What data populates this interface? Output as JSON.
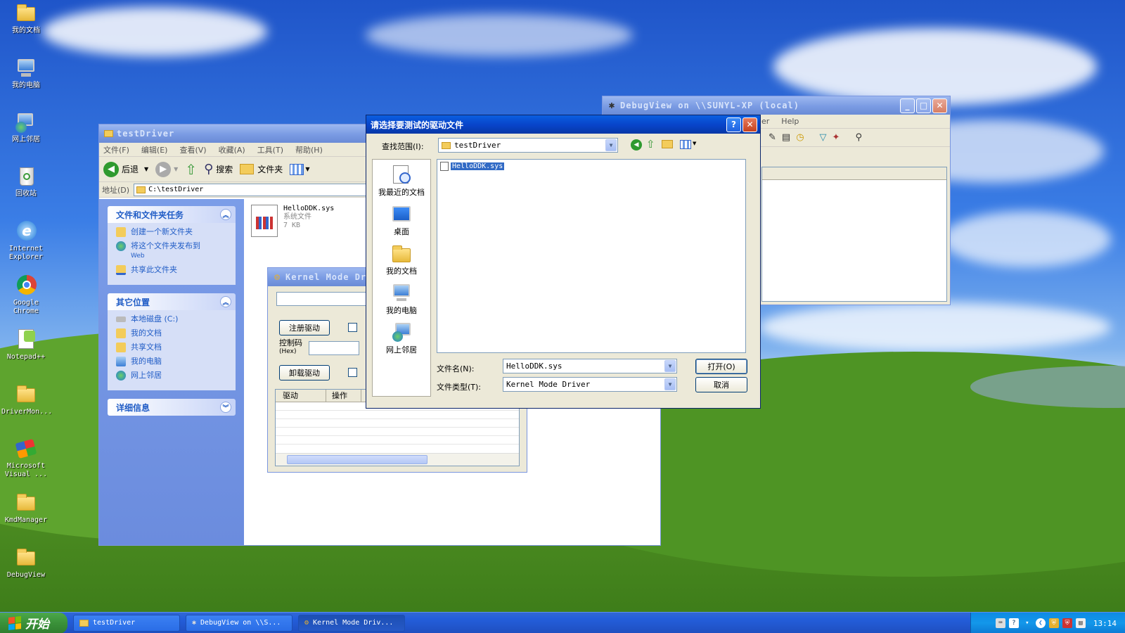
{
  "desktop": {
    "icons": [
      {
        "label": "我的文档"
      },
      {
        "label": "我的电脑"
      },
      {
        "label": "网上邻居"
      },
      {
        "label": "回收站"
      },
      {
        "label": "Internet Explorer"
      },
      {
        "label": "Google Chrome"
      },
      {
        "label": "Notepad++"
      },
      {
        "label": "DriverMon..."
      },
      {
        "label": "Microsoft Visual ..."
      },
      {
        "label": "KmdManager"
      },
      {
        "label": "DebugView"
      }
    ]
  },
  "explorer": {
    "title": "testDriver",
    "menu": [
      "文件(F)",
      "编辑(E)",
      "查看(V)",
      "收藏(A)",
      "工具(T)",
      "帮助(H)"
    ],
    "toolbar": {
      "back": "后退",
      "search": "搜索",
      "folders": "文件夹"
    },
    "address_label": "地址(D)",
    "address_value": "C:\\testDriver",
    "tasks": {
      "title": "文件和文件夹任务",
      "items": [
        {
          "label": "创建一个新文件夹"
        },
        {
          "label": "将这个文件夹发布到",
          "sub": "Web"
        },
        {
          "label": "共享此文件夹"
        }
      ]
    },
    "other_places": {
      "title": "其它位置",
      "items": [
        "本地磁盘 (C:)",
        "我的文档",
        "共享文档",
        "我的电脑",
        "网上邻居"
      ]
    },
    "details": {
      "title": "详细信息"
    },
    "file": {
      "name": "HelloDDK.sys",
      "type": "系统文件",
      "size": "7 KB"
    }
  },
  "kmd": {
    "title": "Kernel Mode Dr",
    "register_btn": "注册驱动",
    "ioctl_label": "控制码",
    "ioctl_hex": "(Hex)",
    "unload_btn": "卸载驱动",
    "columns": [
      "驱动",
      "操作"
    ]
  },
  "debugview": {
    "title": "DebugView on \\\\SUNYL-XP (local)",
    "menu_partial": [
      "er",
      "Help"
    ]
  },
  "dialog": {
    "title": "请选择要测试的驱动文件",
    "lookin_label": "查找范围(I):",
    "lookin_value": "testDriver",
    "places": [
      "我最近的文档",
      "桌面",
      "我的文档",
      "我的电脑",
      "网上邻居"
    ],
    "files": [
      "HelloDDK.sys"
    ],
    "filename_label": "文件名(N):",
    "filename_value": "HelloDDK.sys",
    "filetype_label": "文件类型(T):",
    "filetype_value": "Kernel Mode Driver",
    "open_btn": "打开(O)",
    "cancel_btn": "取消"
  },
  "taskbar": {
    "start": "开始",
    "tasks": [
      "testDriver",
      "DebugView on \\\\S...",
      "Kernel Mode Driv..."
    ],
    "clock": "13:14"
  }
}
